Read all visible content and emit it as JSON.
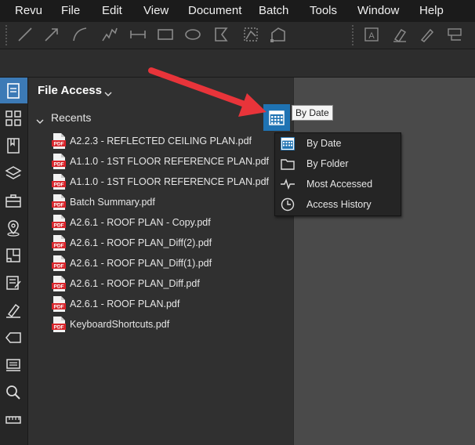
{
  "menu": {
    "items": [
      "Revu",
      "File",
      "Edit",
      "View",
      "Document",
      "Batch",
      "Tools",
      "Window",
      "Help"
    ]
  },
  "toolbar": {
    "tools": [
      "line-icon",
      "arrow-icon",
      "arc-icon",
      "polyline-icon",
      "dimension-icon",
      "rectangle-icon",
      "ellipse-icon",
      "polygon-icon",
      "area-icon",
      "perimeter-icon",
      "text-box-icon",
      "highlight-icon",
      "pen-icon",
      "callout-icon"
    ]
  },
  "rail": {
    "icons": [
      "file-access-icon",
      "thumbnails-icon",
      "bookmarks-icon",
      "layers-icon",
      "toolchest-icon",
      "places-icon",
      "spaces-icon",
      "markups-list-icon",
      "signatures-icon",
      "tags-icon",
      "studio-icon",
      "search-icon",
      "measurements-icon"
    ]
  },
  "panel": {
    "title": "File Access",
    "recents_label": "Recents",
    "files": [
      "A2.2.3 - REFLECTED CEILING PLAN.pdf",
      "A1.1.0 - 1ST FLOOR REFERENCE PLAN.pdf",
      "A1.1.0 - 1ST FLOOR REFERENCE PLAN.pdf",
      "Batch Summary.pdf",
      "A2.6.1 - ROOF PLAN - Copy.pdf",
      "A2.6.1 - ROOF PLAN_Diff(2).pdf",
      "A2.6.1 - ROOF PLAN_Diff(1).pdf",
      "A2.6.1 - ROOF PLAN_Diff.pdf",
      "A2.6.1 - ROOF PLAN.pdf",
      "KeyboardShortcuts.pdf"
    ],
    "pdf_badge": "PDF"
  },
  "sort": {
    "tooltip": "By Date",
    "options": [
      {
        "label": "By Date",
        "icon": "calendar-icon"
      },
      {
        "label": "By Folder",
        "icon": "folder-icon"
      },
      {
        "label": "Most Accessed",
        "icon": "pulse-icon"
      },
      {
        "label": "Access History",
        "icon": "clock-icon"
      }
    ]
  },
  "colors": {
    "accent": "#1f73b3",
    "annotation_arrow": "#e8343a",
    "pdf_red": "#d8242a"
  }
}
